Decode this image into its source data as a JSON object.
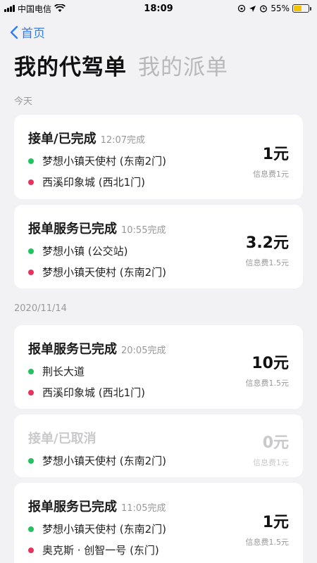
{
  "statusbar": {
    "carrier": "中国电信",
    "time": "18:09",
    "battery": "55%",
    "battery_level": 0.55
  },
  "nav": {
    "back_label": "首页"
  },
  "tabs": {
    "active": "我的代驾单",
    "inactive": "我的派单"
  },
  "sections": {
    "today": "今天",
    "date2": "2020/11/14"
  },
  "orders": [
    {
      "status": "接单/已完成",
      "time": "12:07完成",
      "from": "梦想小镇天使村 (东南2门)",
      "to": "西溪印象城 (西北1门)",
      "amount": "1元",
      "fee": "信息费1元"
    },
    {
      "status": "报单服务已完成",
      "time": "10:55完成",
      "from": "梦想小镇 (公交站)",
      "to": "梦想小镇天使村 (东南2门)",
      "amount": "3.2元",
      "fee": "信息费1.5元"
    },
    {
      "status": "报单服务已完成",
      "time": "20:05完成",
      "from": "荆长大道",
      "to": "西溪印象城 (西北1门)",
      "amount": "10元",
      "fee": "信息费1.5元"
    },
    {
      "status": "接单/已取消",
      "from": "梦想小镇天使村 (东南2门)",
      "amount": "0元",
      "fee": "信息费1元"
    },
    {
      "status": "报单服务已完成",
      "time": "11:05完成",
      "from": "梦想小镇天使村 (东南2门)",
      "to": "奥克斯 · 创智一号 (东门)",
      "amount": "1元",
      "fee": "信息费1.5元"
    }
  ],
  "colors": {
    "accent": "#2d7df6",
    "origin_dot": "#23c161",
    "destination_dot": "#e8345b",
    "battery": "#f5c400"
  }
}
